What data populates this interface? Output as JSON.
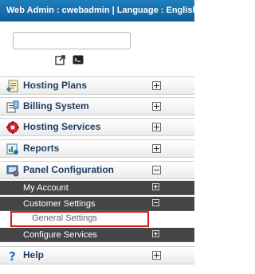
{
  "header": {
    "title": "Web Admin : cwebadmin | Language : English"
  },
  "search": {
    "value": "",
    "placeholder": ""
  },
  "toolbar": {
    "tools": [
      "external-link-icon",
      "terminal-icon"
    ]
  },
  "menu": {
    "items": [
      {
        "label": "Hosting Plans",
        "icon": "hosting-plans-icon",
        "state": "collapsed"
      },
      {
        "label": "Billing System",
        "icon": "billing-icon",
        "state": "collapsed"
      },
      {
        "label": "Hosting Services",
        "icon": "services-gear-icon",
        "state": "collapsed"
      },
      {
        "label": "Reports",
        "icon": "reports-icon",
        "state": "collapsed"
      },
      {
        "label": "Panel Configuration",
        "icon": "panel-configuration-icon",
        "state": "expanded"
      },
      {
        "label": "Help",
        "icon": "help-icon",
        "state": "collapsed"
      }
    ],
    "panel_configuration": {
      "subitems": [
        {
          "label": "My Account",
          "state": "collapsed"
        },
        {
          "label": "Customer Settings",
          "state": "expanded"
        },
        {
          "label": "Configure Services",
          "state": "collapsed"
        }
      ],
      "customer_settings": {
        "subitems": [
          {
            "label": "General Settings",
            "selected": true
          }
        ]
      }
    }
  },
  "colors": {
    "header": "#1b74b2",
    "submenu": "#454545",
    "highlight": "#d21f1f",
    "menu_text": "#1d3d5f"
  }
}
